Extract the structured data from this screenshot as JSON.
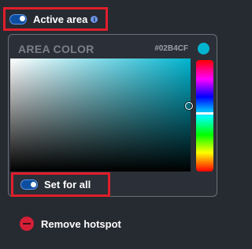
{
  "active_area": {
    "label": "Active area",
    "enabled": true,
    "info_icon": "i"
  },
  "color_panel": {
    "title": "AREA COLOR",
    "hex": "#02B4CF",
    "swatch_color": "#02B4CF",
    "set_for_all": {
      "label": "Set for all",
      "enabled": true
    }
  },
  "remove_hotspot": {
    "label": "Remove hotspot",
    "icon": "minus-circle-icon",
    "icon_color": "#d61f37"
  },
  "accent_color": "#e01e2b"
}
